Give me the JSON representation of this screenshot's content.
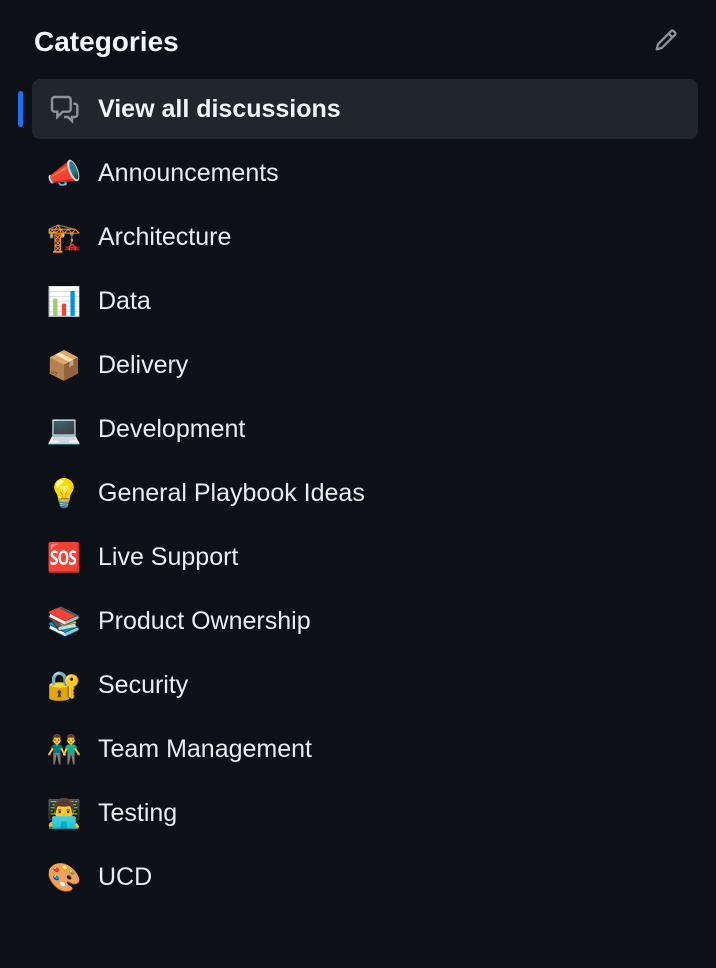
{
  "header": {
    "title": "Categories"
  },
  "categories": [
    {
      "icon_type": "svg-discussions",
      "label": "View all discussions",
      "active": true
    },
    {
      "icon_type": "emoji",
      "icon": "📣",
      "label": "Announcements",
      "active": false
    },
    {
      "icon_type": "emoji",
      "icon": "🏗️",
      "label": "Architecture",
      "active": false
    },
    {
      "icon_type": "emoji",
      "icon": "📊",
      "label": "Data",
      "active": false
    },
    {
      "icon_type": "emoji",
      "icon": "📦",
      "label": "Delivery",
      "active": false
    },
    {
      "icon_type": "emoji",
      "icon": "💻",
      "label": "Development",
      "active": false
    },
    {
      "icon_type": "emoji",
      "icon": "💡",
      "label": "General Playbook Ideas",
      "active": false
    },
    {
      "icon_type": "emoji",
      "icon": "🆘",
      "label": "Live Support",
      "active": false
    },
    {
      "icon_type": "emoji",
      "icon": "📚",
      "label": "Product Ownership",
      "active": false
    },
    {
      "icon_type": "emoji",
      "icon": "🔐",
      "label": "Security",
      "active": false
    },
    {
      "icon_type": "emoji",
      "icon": "👬",
      "label": "Team Management",
      "active": false
    },
    {
      "icon_type": "emoji",
      "icon": "👨‍💻",
      "label": "Testing",
      "active": false
    },
    {
      "icon_type": "emoji",
      "icon": "🎨",
      "label": "UCD",
      "active": false
    }
  ]
}
